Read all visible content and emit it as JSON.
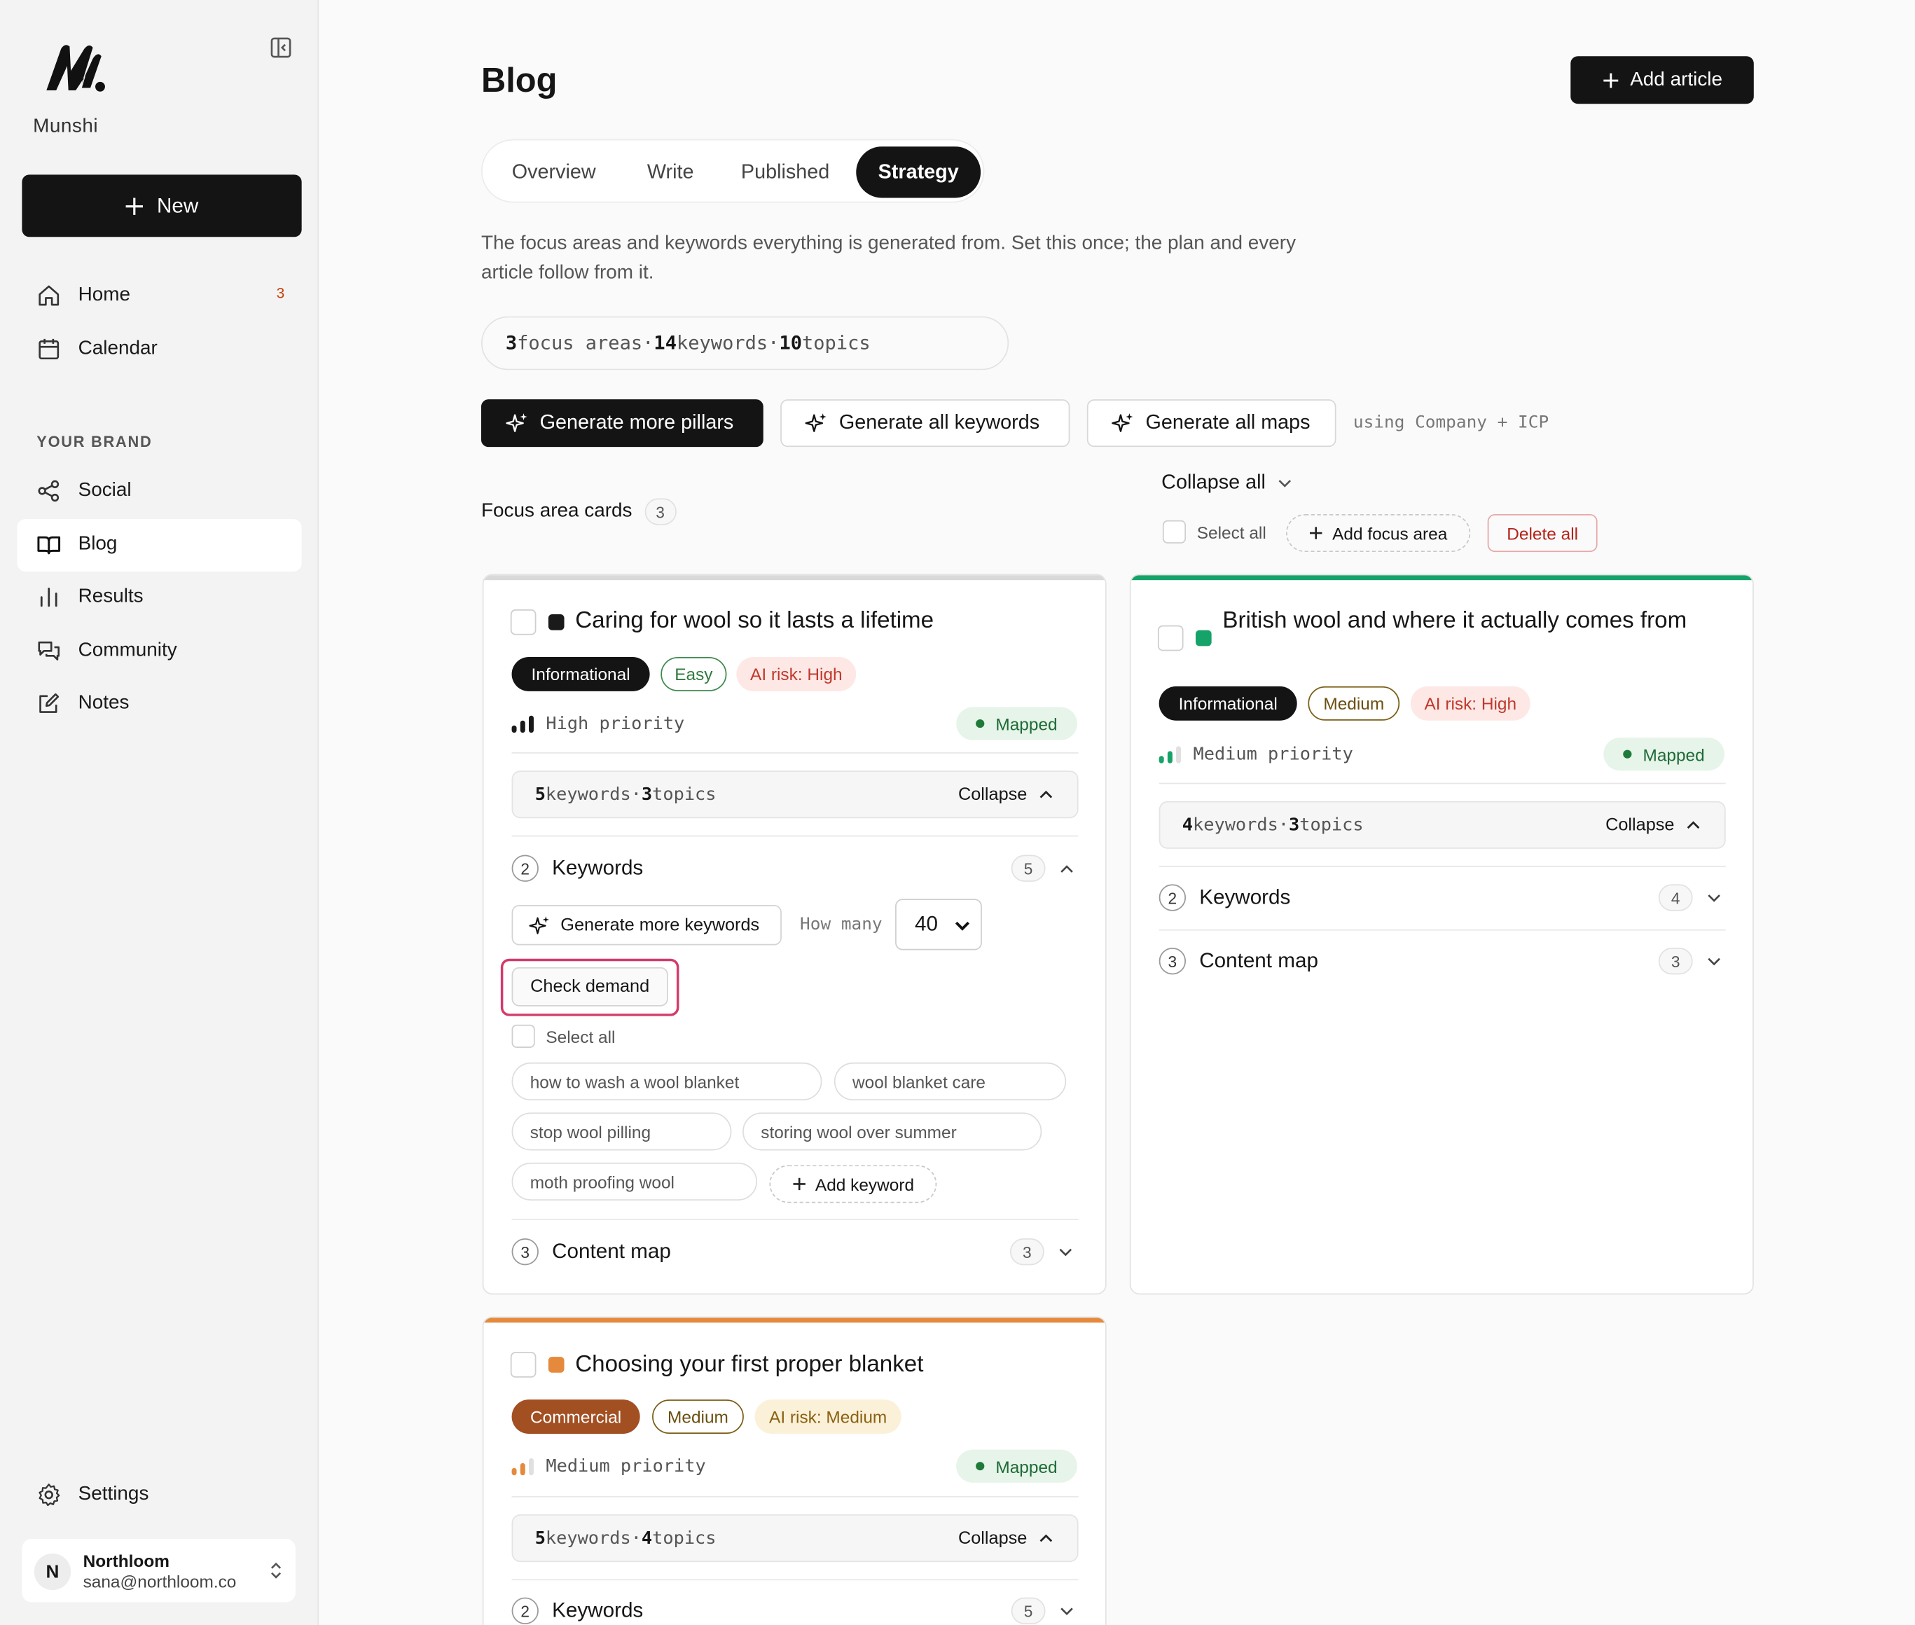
{
  "brand": {
    "name": "Munshi"
  },
  "sidebar": {
    "new_label": "New",
    "nav": [
      {
        "label": "Home",
        "badge": "3"
      },
      {
        "label": "Calendar"
      }
    ],
    "section_label": "YOUR BRAND",
    "brand_nav": [
      {
        "label": "Social"
      },
      {
        "label": "Blog",
        "active": true
      },
      {
        "label": "Results"
      },
      {
        "label": "Community"
      },
      {
        "label": "Notes"
      }
    ],
    "settings_label": "Settings",
    "account": {
      "initial": "N",
      "name": "Northloom",
      "email": "sana@northloom.co"
    }
  },
  "header": {
    "title": "Blog",
    "add_article_label": "Add article"
  },
  "tabs": [
    {
      "label": "Overview"
    },
    {
      "label": "Write"
    },
    {
      "label": "Published"
    },
    {
      "label": "Strategy",
      "active": true
    }
  ],
  "description": "The focus areas and keywords everything is generated from. Set this once; the plan and every article follow from it.",
  "stats": {
    "focus_areas": "3",
    "focus_areas_label": "focus areas",
    "keywords": "14",
    "keywords_label": "keywords",
    "topics": "10",
    "topics_label": "topics",
    "separator": "·"
  },
  "actions": {
    "generate_pillars": "Generate more pillars",
    "generate_keywords": "Generate all keywords",
    "generate_maps": "Generate all maps",
    "using_note": "using Company + ICP"
  },
  "toolbar": {
    "collapse_all": "Collapse all",
    "section_title": "Focus area cards",
    "section_count": "3",
    "select_all": "Select all",
    "add_focus_area": "Add focus area",
    "delete_all": "Delete all"
  },
  "cards": [
    {
      "title": "Caring for wool so it lasts a lifetime",
      "accent": "#d9d9d9",
      "dot_color": "#1a1a1a",
      "intent": "Informational",
      "difficulty": "Easy",
      "ai_risk": "AI risk: High",
      "priority": "High priority",
      "priority_level": 3,
      "priority_color": "#1a1a1a",
      "status": "Mapped",
      "keyword_count": "5",
      "keyword_label": "keywords",
      "topic_count": "3",
      "topic_label": "topics",
      "toggle_label": "Collapse",
      "keywords_section": {
        "num": "2",
        "label": "Keywords",
        "count": "5"
      },
      "generate_label": "Generate more keywords",
      "how_many_label": "How many",
      "how_many_value": "40",
      "check_demand_label": "Check demand",
      "select_all_label": "Select all",
      "keywords": [
        "how to wash a wool blanket",
        "wool blanket care",
        "stop wool pilling",
        "storing wool over summer",
        "moth proofing wool"
      ],
      "add_keyword_label": "Add keyword",
      "content_map_section": {
        "num": "3",
        "label": "Content map",
        "count": "3"
      }
    },
    {
      "title": "British wool and where it actually comes from",
      "accent": "#16a36a",
      "dot_color": "#16a36a",
      "intent": "Informational",
      "difficulty": "Medium",
      "ai_risk": "AI risk: High",
      "priority": "Medium priority",
      "priority_level": 2,
      "priority_color": "#16a36a",
      "status": "Mapped",
      "keyword_count": "4",
      "keyword_label": "keywords",
      "topic_count": "3",
      "topic_label": "topics",
      "toggle_label": "Collapse",
      "keywords_section": {
        "num": "2",
        "label": "Keywords",
        "count": "4"
      },
      "content_map_section": {
        "num": "3",
        "label": "Content map",
        "count": "3"
      }
    },
    {
      "title": "Choosing your first proper blanket",
      "accent": "#e58a3c",
      "dot_color": "#e58a3c",
      "intent": "Commercial",
      "difficulty": "Medium",
      "ai_risk": "AI risk: Medium",
      "priority": "Medium priority",
      "priority_level": 2,
      "priority_color": "#e58a3c",
      "status": "Mapped",
      "keyword_count": "5",
      "keyword_label": "keywords",
      "topic_count": "4",
      "topic_label": "topics",
      "toggle_label": "Collapse",
      "keywords_section": {
        "num": "2",
        "label": "Keywords",
        "count": "5"
      }
    }
  ]
}
